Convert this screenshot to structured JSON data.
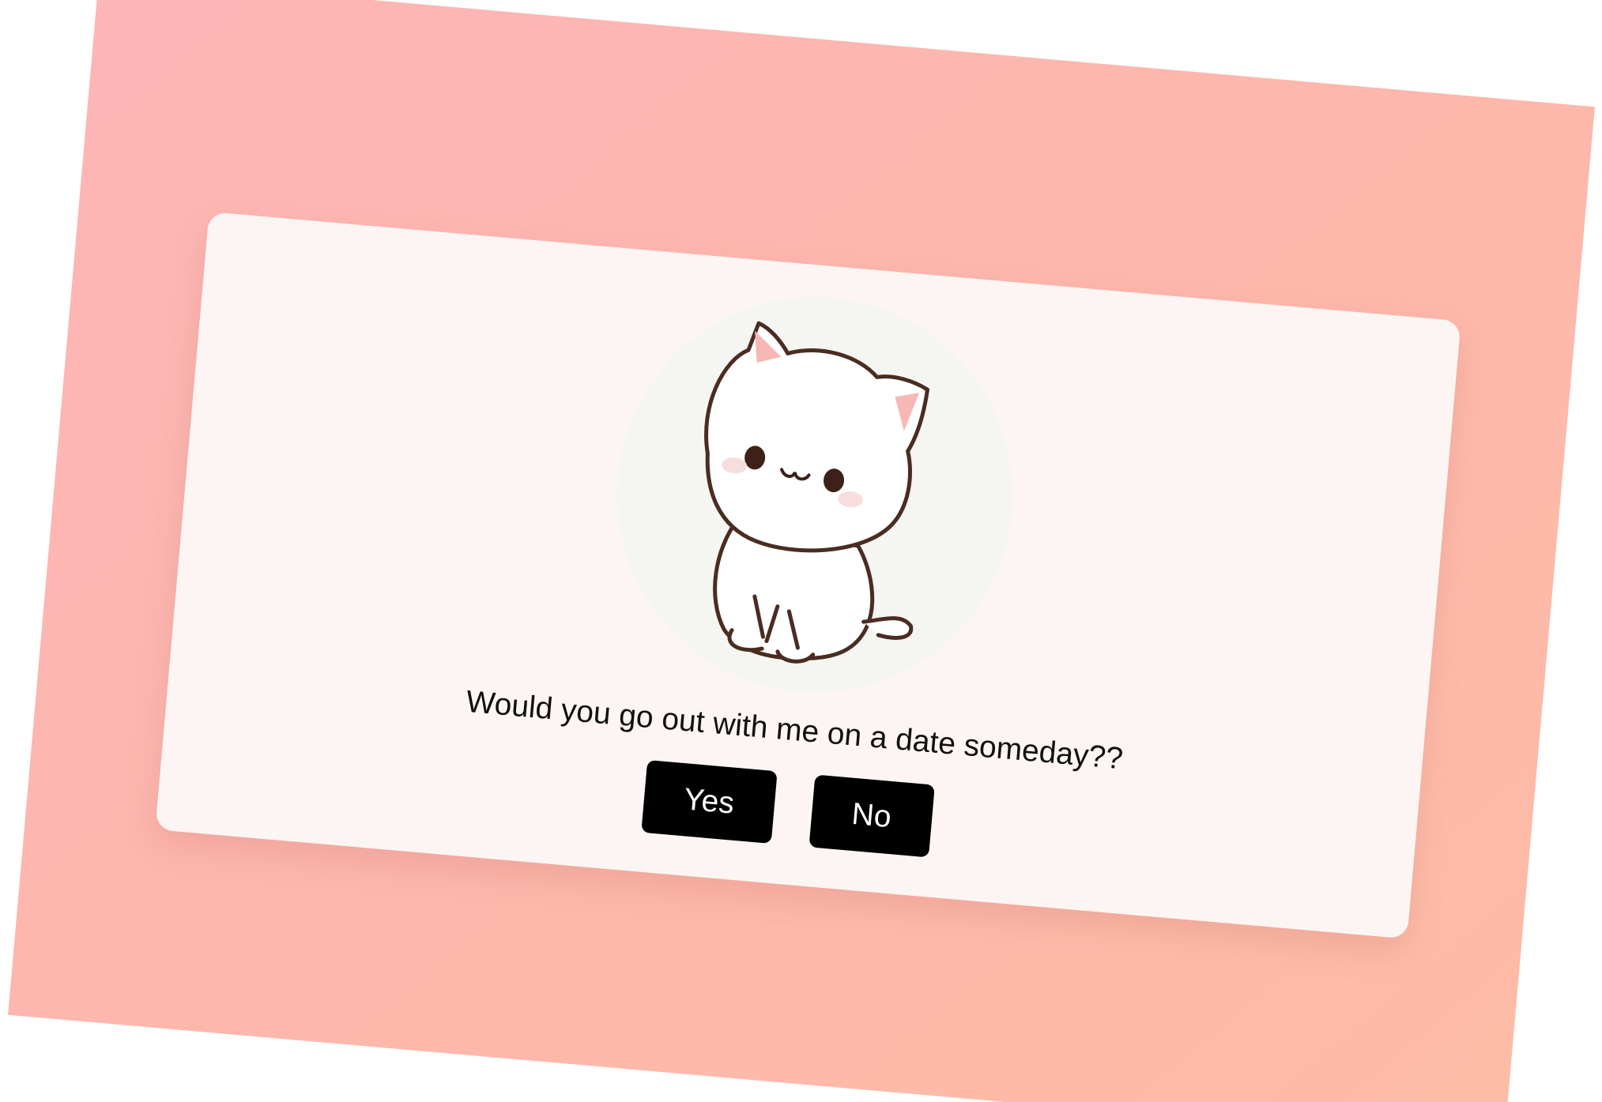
{
  "card": {
    "question": "Would you go out with me on a date someday??",
    "yes_label": "Yes",
    "no_label": "No"
  },
  "image": {
    "icon": "cat-illustration"
  },
  "colors": {
    "background_start": "#fdb6b6",
    "background_end": "#fdbca6",
    "card": "#fdf5f3",
    "button": "#000000",
    "button_text": "#ffffff"
  }
}
